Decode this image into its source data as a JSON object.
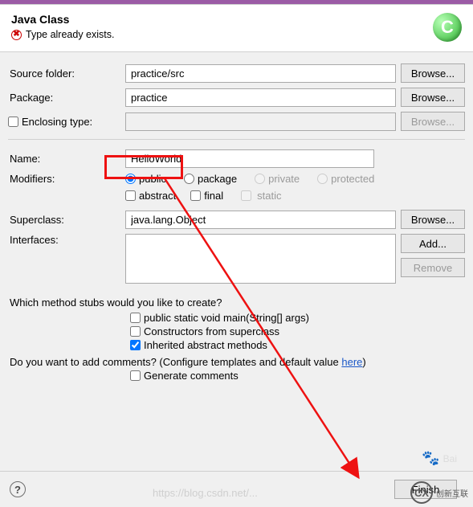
{
  "header": {
    "title": "Java Class",
    "error": "Type already exists.",
    "icon_letter": "C"
  },
  "labels": {
    "source_folder": "Source folder:",
    "package": "Package:",
    "enclosing_type": "Enclosing type:",
    "name": "Name:",
    "modifiers": "Modifiers:",
    "superclass": "Superclass:",
    "interfaces": "Interfaces:"
  },
  "fields": {
    "source_folder": "practice/src",
    "package": "practice",
    "enclosing_type": "",
    "name": "HelloWorld",
    "superclass": "java.lang.Object"
  },
  "buttons": {
    "browse": "Browse...",
    "add": "Add...",
    "remove": "Remove",
    "finish": "Finish"
  },
  "modifiers": {
    "public": "public",
    "package_kw": "package",
    "private": "private",
    "protected": "protected",
    "abstract": "abstract",
    "final": "final",
    "static": "static"
  },
  "questions": {
    "stubs": "Which method stubs would you like to create?",
    "main": "public static void main(String[] args)",
    "ctors": "Constructors from superclass",
    "inherited": "Inherited abstract methods",
    "comments_pre": "Do you want to add comments? (Configure templates and default value ",
    "here": "here",
    "comments_post": ")",
    "generate": "Generate comments"
  },
  "help": "?",
  "watermark_url": "https://blog.csdn.net/...",
  "watermark_brand1": "Bai",
  "watermark_brand2": "创新互联"
}
